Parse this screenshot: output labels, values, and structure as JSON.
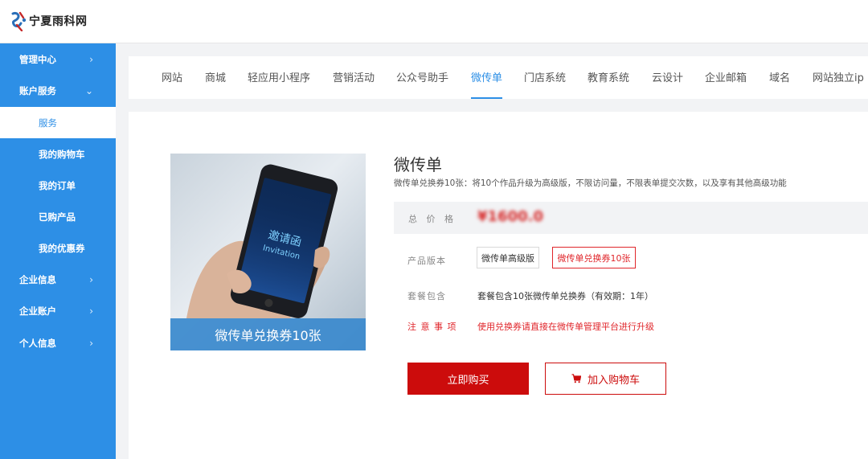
{
  "brand": {
    "name": "宁夏雨科网"
  },
  "sidebar": {
    "items": [
      {
        "label": "管理中心",
        "chevron": "›"
      },
      {
        "label": "账户服务",
        "chevron": "⌄"
      }
    ],
    "subitems": [
      {
        "label": "服务"
      },
      {
        "label": "我的购物车"
      },
      {
        "label": "我的订单"
      },
      {
        "label": "已购产品"
      },
      {
        "label": "我的优惠券"
      }
    ],
    "items_after": [
      {
        "label": "企业信息",
        "chevron": "›"
      },
      {
        "label": "企业账户",
        "chevron": "›"
      },
      {
        "label": "个人信息",
        "chevron": "›"
      }
    ]
  },
  "tabs": [
    {
      "label": "网站"
    },
    {
      "label": "商城"
    },
    {
      "label": "轻应用小程序"
    },
    {
      "label": "营销活动"
    },
    {
      "label": "公众号助手"
    },
    {
      "label": "微传单"
    },
    {
      "label": "门店系统"
    },
    {
      "label": "教育系统"
    },
    {
      "label": "云设计"
    },
    {
      "label": "企业邮箱"
    },
    {
      "label": "域名"
    },
    {
      "label": "网站独立ip"
    }
  ],
  "active_tab": "微传单",
  "product": {
    "image_banner": "微传单兑换券10张",
    "title": "微传单",
    "subtitle": "微传单兑换券10张：将10个作品升级为高级版，不限访问量，不限表单提交次数，以及享有其他高级功能",
    "price_label": "总 价 格",
    "price_value": "¥1600.0",
    "version_label": "产品版本",
    "versions": [
      {
        "label": "微传单高级版",
        "selected": false
      },
      {
        "label": "微传单兑换券10张",
        "selected": true
      }
    ],
    "package_label": "套餐包含",
    "package_value": "套餐包含10张微传单兑换券（有效期：1年）",
    "notice_label": "注 意 事 项",
    "notice_value": "使用兑换券请直接在微传单管理平台进行升级"
  },
  "actions": {
    "buy_label": "立即购买",
    "cart_label": "加入购物车"
  },
  "colors": {
    "sidebar_bg": "#2d8fe6",
    "accent": "#2d8fe6",
    "buy_red": "#cc0c0c",
    "warn_red": "#e0262b"
  }
}
